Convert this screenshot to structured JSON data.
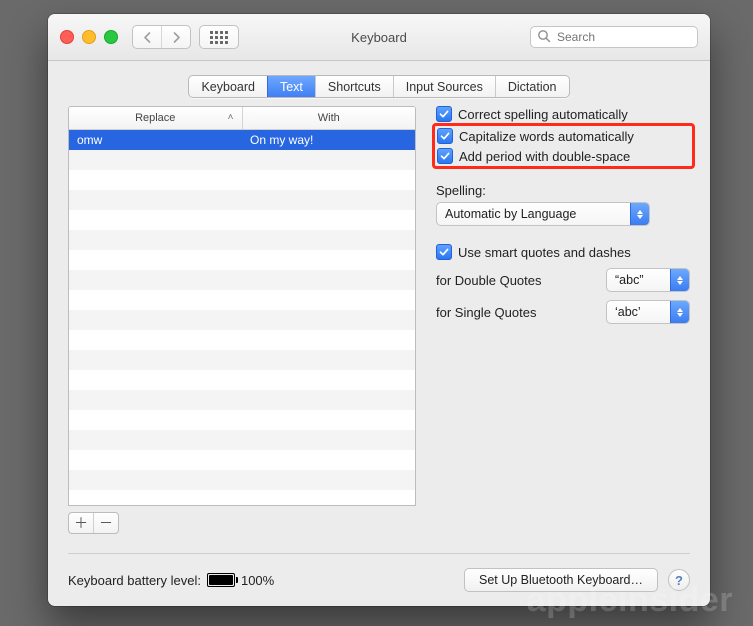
{
  "window": {
    "title": "Keyboard"
  },
  "search": {
    "placeholder": "Search"
  },
  "tabs": {
    "items": [
      "Keyboard",
      "Text",
      "Shortcuts",
      "Input Sources",
      "Dictation"
    ],
    "active_index": 1
  },
  "table": {
    "header_replace": "Replace",
    "header_with": "With",
    "rows": [
      {
        "replace": "omw",
        "with": "On my way!",
        "selected": true
      }
    ],
    "filler_rows": 17
  },
  "options": {
    "correct_spelling": {
      "label": "Correct spelling automatically",
      "checked": true
    },
    "capitalize": {
      "label": "Capitalize words automatically",
      "checked": true
    },
    "add_period": {
      "label": "Add period with double-space",
      "checked": true
    },
    "spelling_label": "Spelling:",
    "spelling_value": "Automatic by Language",
    "smart_quotes": {
      "label": "Use smart quotes and dashes",
      "checked": true
    },
    "double_quotes_label": "for Double Quotes",
    "double_quotes_value": "“abc”",
    "single_quotes_label": "for Single Quotes",
    "single_quotes_value": "‘abc’"
  },
  "footer": {
    "battery_label": "Keyboard battery level:",
    "battery_percent": "100%",
    "bluetooth_button": "Set Up Bluetooth Keyboard…"
  },
  "watermark": "appleinsider"
}
